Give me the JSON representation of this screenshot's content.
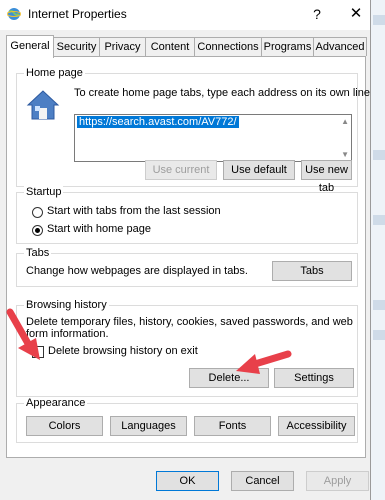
{
  "window": {
    "title": "Internet Properties",
    "help_label": "?",
    "close_label": "✕"
  },
  "tabs": [
    {
      "label": "General",
      "active": true
    },
    {
      "label": "Security"
    },
    {
      "label": "Privacy"
    },
    {
      "label": "Content"
    },
    {
      "label": "Connections"
    },
    {
      "label": "Programs"
    },
    {
      "label": "Advanced"
    }
  ],
  "home_page": {
    "legend": "Home page",
    "instruction": "To create home page tabs, type each address on its own line.",
    "url": "https://search.avast.com/AV772/",
    "use_current": "Use current",
    "use_default": "Use default",
    "use_new_tab": "Use new tab"
  },
  "startup": {
    "legend": "Startup",
    "option_tabs": "Start with tabs from the last session",
    "option_home": "Start with home page",
    "selected": "option_home"
  },
  "tabs_group": {
    "legend": "Tabs",
    "description": "Change how webpages are displayed in tabs.",
    "button": "Tabs"
  },
  "browsing_history": {
    "legend": "Browsing history",
    "description_line1": "Delete temporary files, history, cookies, saved passwords, and web",
    "description_line2": "form information.",
    "delete_on_exit": "Delete browsing history on exit",
    "delete_on_exit_checked": false,
    "delete_button": "Delete...",
    "settings_button": "Settings"
  },
  "appearance": {
    "legend": "Appearance",
    "colors": "Colors",
    "languages": "Languages",
    "fonts": "Fonts",
    "accessibility": "Accessibility"
  },
  "footer": {
    "ok": "OK",
    "cancel": "Cancel",
    "apply": "Apply"
  },
  "colors": {
    "selection": "#0078d7",
    "annotation_arrow": "#e8404a"
  }
}
